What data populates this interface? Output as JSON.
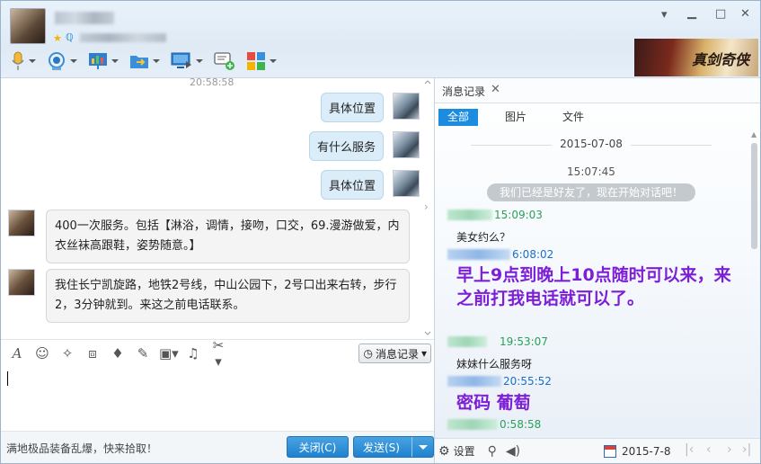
{
  "header": {
    "controls": {
      "minimize": "▁",
      "restore": "□",
      "close": "✕",
      "dropdown": "▾"
    },
    "banner_text": "真剑奇侠"
  },
  "chat": {
    "top_time": "20:58:58",
    "right_messages": [
      "具体位置",
      "有什么服务",
      "具体位置"
    ],
    "left_messages": [
      "400一次服务。包括【淋浴，调情，接吻，口交，69.漫游做爱，内衣丝袜高跟鞋，姿势随意。】",
      "我住长宁凯旋路，地铁2号线，中山公园下，2号口出来右转，步行2，3分钟就到。来这之前电话联系。"
    ]
  },
  "input_toolbar": {
    "history_button": "消息记录"
  },
  "bottom": {
    "ad_text": "满地极品装备乱爆，快来拾取！",
    "close_button": "关闭(C)",
    "send_button": "发送(S)"
  },
  "history": {
    "tab_label": "消息记录",
    "tab_close": "✕",
    "filters": [
      "全部",
      "图片",
      "文件"
    ],
    "date_header": "2015-07-08",
    "first_time": "15:07:45",
    "system_notice": "我们已经是好友了，现在开始对话吧！",
    "entries": [
      {
        "time": "15:09:03",
        "text": "美女约么？"
      },
      {
        "time": "6:08:02",
        "text": "早上9点到晚上10点随时可以来，来之前打我电话就可以了。"
      },
      {
        "time": "19:53:07",
        "text": "妹妹什么服务呀"
      },
      {
        "time": "20:55:52",
        "text": "密码  葡萄"
      },
      {
        "time": "0:58:58",
        "text": ""
      }
    ],
    "settings_label": "设置",
    "date_picker": "2015-7-8"
  }
}
